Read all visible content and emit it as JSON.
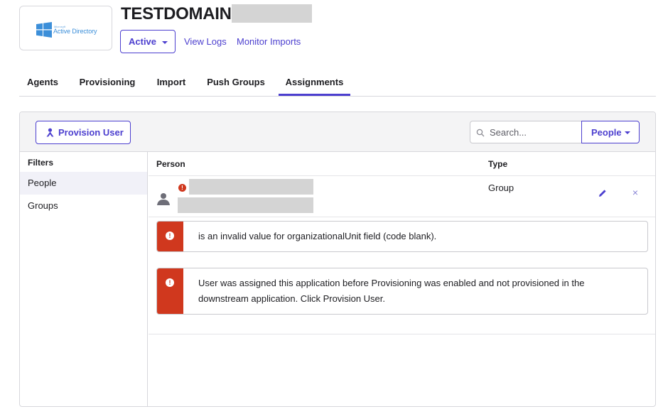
{
  "app": {
    "title": "TESTDOMAIN",
    "logo_text": "Active Directory",
    "logo_small": "Microsoft",
    "status_label": "Active",
    "links": [
      "View Logs",
      "Monitor Imports"
    ]
  },
  "tabs": [
    {
      "label": "Agents",
      "active": false
    },
    {
      "label": "Provisioning",
      "active": false
    },
    {
      "label": "Import",
      "active": false
    },
    {
      "label": "Push Groups",
      "active": false
    },
    {
      "label": "Assignments",
      "active": true
    }
  ],
  "toolbar": {
    "provision_label": "Provision User",
    "search_placeholder": "Search...",
    "people_label": "People"
  },
  "filters": {
    "heading": "Filters",
    "items": [
      {
        "label": "People",
        "active": true
      },
      {
        "label": "Groups",
        "active": false
      }
    ]
  },
  "table": {
    "columns": [
      "Person",
      "Type"
    ],
    "rows": [
      {
        "type": "Group"
      }
    ]
  },
  "alerts": [
    "is an invalid value for organizationalUnit field (code blank).",
    "User was assigned this application before Provisioning was enabled and not provisioned in the downstream application. Click Provision User."
  ],
  "colors": {
    "accent": "#4c3fcf",
    "error": "#d0381e",
    "border": "#d7d7dc",
    "toolbar_bg": "#f4f4f5",
    "redaction": "#d4d4d4"
  },
  "icons": [
    "windows-logo-icon",
    "provision-user-icon",
    "search-icon",
    "caret-down-icon",
    "avatar-icon",
    "error-icon",
    "pencil-icon",
    "close-icon"
  ]
}
